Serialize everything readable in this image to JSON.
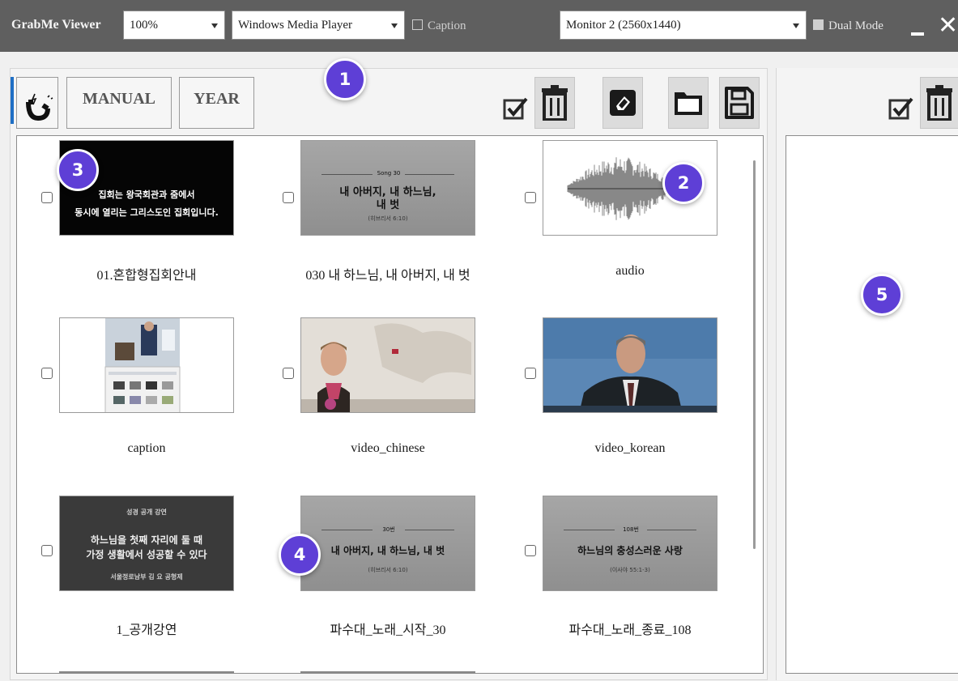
{
  "app_title": "GrabMe Viewer",
  "zoom": {
    "value": "100%"
  },
  "player": {
    "value": "Windows Media Player"
  },
  "caption_toggle": {
    "label": "Caption",
    "checked": false
  },
  "monitor": {
    "value": "Monitor 2 (2560x1440)"
  },
  "dual_mode": {
    "label": "Dual Mode",
    "checked": false
  },
  "toolbar": {
    "manual_label": "MANUAL",
    "year_label": "YEAR"
  },
  "badges": [
    "1",
    "2",
    "3",
    "4",
    "5"
  ],
  "items": [
    {
      "name": "01.혼합형집회안내",
      "thumb": "black",
      "lines": [
        "집회는 왕국회관과 줌에서",
        "동시에 열리는 그리스도인 집회입니다."
      ],
      "checked": false
    },
    {
      "name": "030 내 하느님, 내 아버지, 내 벗",
      "thumb": "grey",
      "header": "Song 30",
      "lines": [
        "내 아버지, 내 하느님,",
        "내 벗"
      ],
      "sub": "(히브리서 6:10)",
      "checked": false
    },
    {
      "name": "audio",
      "thumb": "waveform",
      "checked": false
    },
    {
      "name": "caption",
      "thumb": "screenshot",
      "checked": false
    },
    {
      "name": "video_chinese",
      "thumb": "presenter-map",
      "checked": false
    },
    {
      "name": "video_korean",
      "thumb": "presenter-blue",
      "checked": false
    },
    {
      "name": "1_공개강연",
      "thumb": "dark",
      "header": "성경 공개 강연",
      "lines": [
        "하느님을 첫째 자리에 둘 때",
        "가정 생활에서 성공할 수 있다"
      ],
      "sub": "서울정로남부  김 요 공형제",
      "checked": false
    },
    {
      "name": "파수대_노래_시작_30",
      "thumb": "grey",
      "header": "30번",
      "lines": [
        "내 아버지, 내 하느님, 내 벗"
      ],
      "sub": "(히브리서 6:10)",
      "checked": false
    },
    {
      "name": "파수대_노래_종료_108",
      "thumb": "grey",
      "header": "108번",
      "lines": [
        "하느님의 충성스러운 사랑"
      ],
      "sub": "(이사야 55:1-3)",
      "checked": false
    }
  ],
  "colors": {
    "titlebar": "#5f5f5f",
    "badge": "#5e3fd6",
    "accent": "#1f6fc5"
  }
}
